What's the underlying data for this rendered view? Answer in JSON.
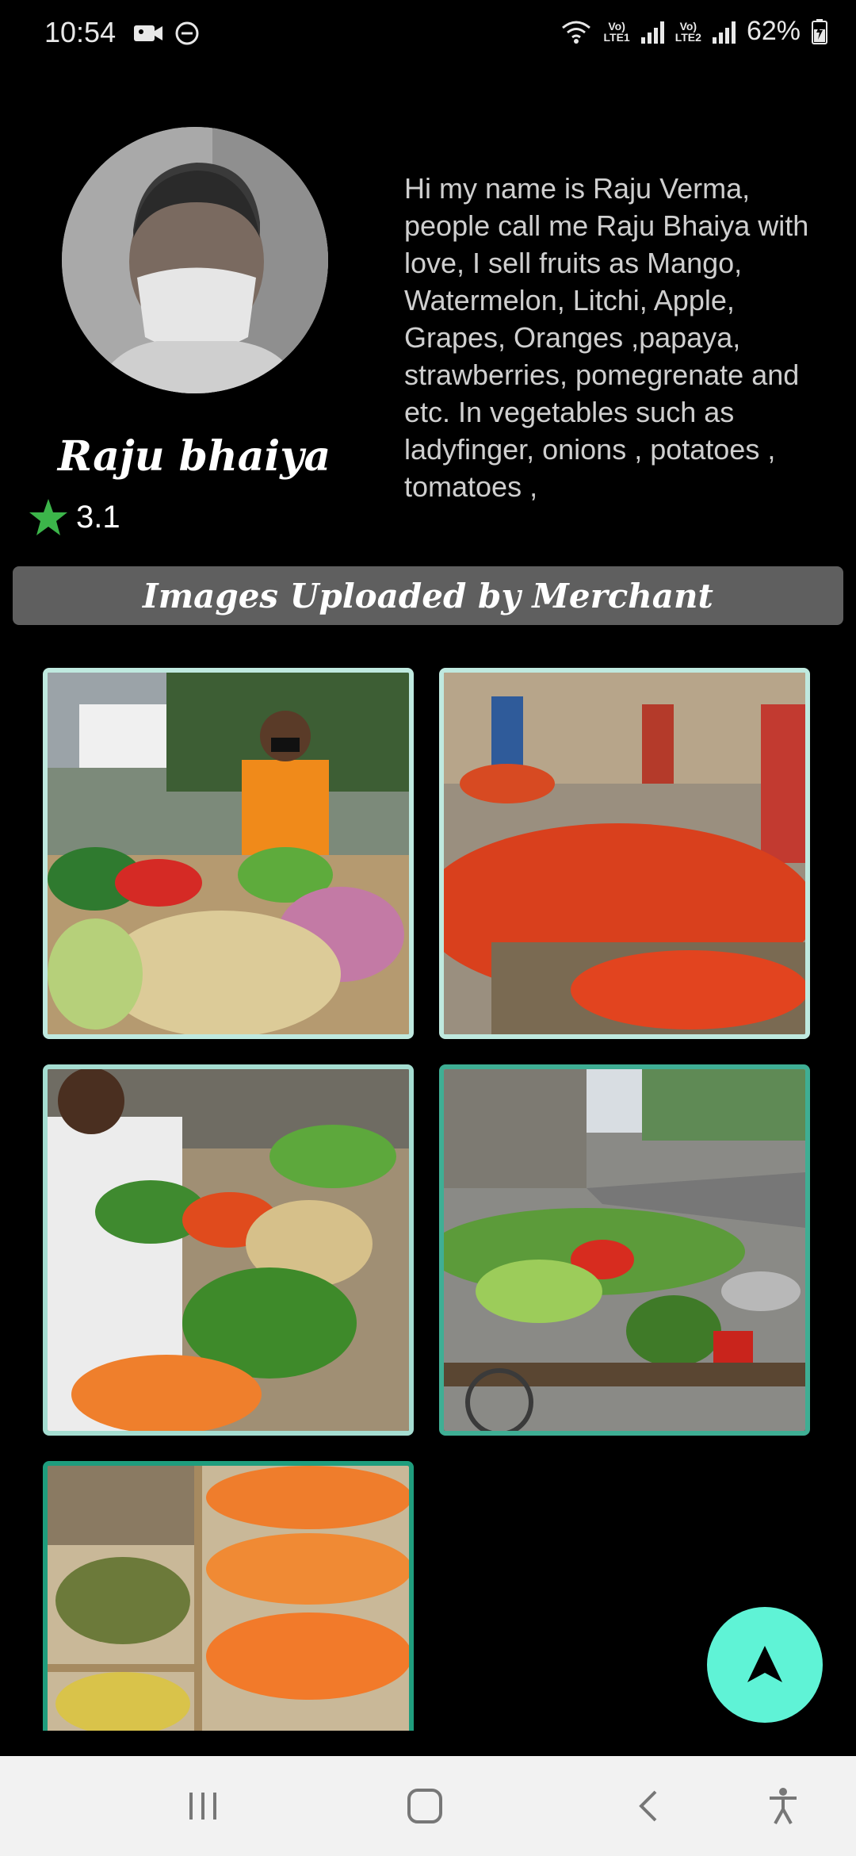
{
  "status_bar": {
    "time": "10:54",
    "battery_percent": "62%",
    "volte_1": "Vo)\nLTE1",
    "volte_2": "Vo)\nLTE2",
    "icons": [
      "video-camera-icon",
      "do-not-disturb-icon",
      "wifi-icon",
      "signal-icon",
      "battery-icon"
    ]
  },
  "profile": {
    "name": "Raju bhaiya",
    "rating": "3.1",
    "bio": "Hi my name is Raju Verma, people call me Raju Bhaiya with love, I sell fruits as Mango, Watermelon, Litchi, Apple, Grapes, Oranges ,papaya, strawberries, pomegrenate and etc. In vegetables  such as ladyfinger, onions , potatoes , tomatoes ,"
  },
  "gallery": {
    "title": "Images Uploaded by Merchant",
    "images": [
      {
        "subject": "vegetable stall with vendor in orange shirt"
      },
      {
        "subject": "market with piles of tomatoes"
      },
      {
        "subject": "vendor arranging vegetables on cart"
      },
      {
        "subject": "vegetable cart on street with scale"
      },
      {
        "subject": "crates of apricots and fruits"
      }
    ]
  },
  "colors": {
    "background": "#000000",
    "banner": "#5f5f5f",
    "fab": "#5ff3d6",
    "star": "#3cb54a",
    "tile_border": "#6ec9b9"
  },
  "navigation": {
    "buttons": [
      "recent-apps",
      "home",
      "back",
      "accessibility"
    ]
  }
}
